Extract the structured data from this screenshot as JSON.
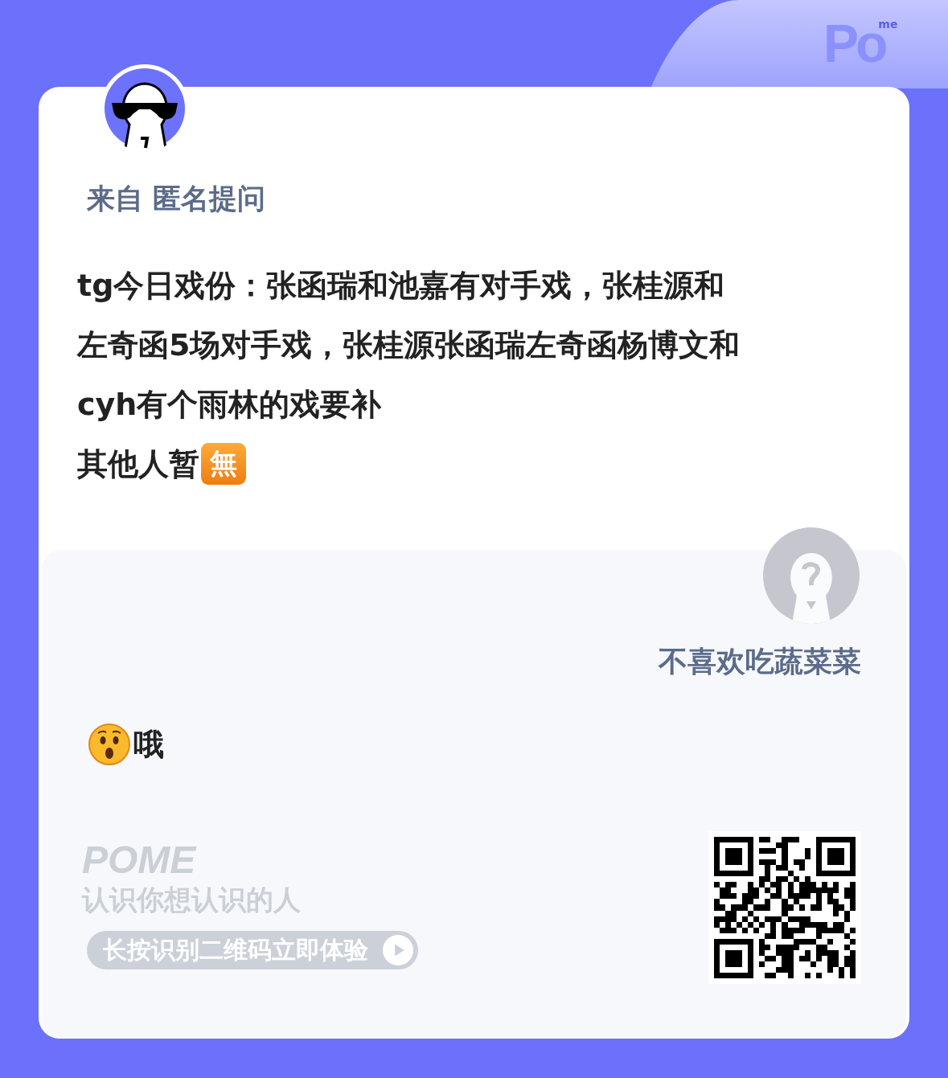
{
  "logo": {
    "main": "Po",
    "sup": "me"
  },
  "question": {
    "from_label": "来自",
    "from_name": "匿名提问",
    "lines": [
      {
        "text": "tg今日戏份：张函瑞和池嘉有对手戏，张桂源和"
      },
      {
        "text": "左奇函5场对手戏，张桂源张函瑞左奇函杨博文和"
      },
      {
        "text": "cyh有个雨林的戏要补"
      },
      {
        "text": "其他人暂",
        "badge": "無"
      }
    ]
  },
  "answer": {
    "author": "不喜欢吃蔬菜菜",
    "text": "哦"
  },
  "branding": {
    "brand": "POME",
    "slogan": "认识你想认识的人",
    "cta": "长按识别二维码立即体验"
  }
}
